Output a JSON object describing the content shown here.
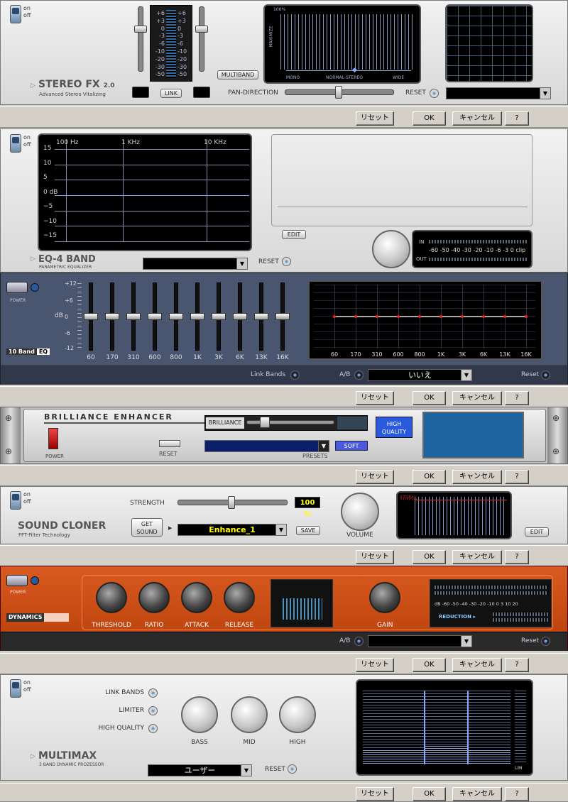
{
  "common": {
    "on": "on",
    "off": "off",
    "reset": "リセット",
    "ok": "OK",
    "cancel": "キャンセル",
    "help": "?"
  },
  "stereo": {
    "title": "STEREO FX",
    "version": "2.0",
    "subtitle": "Advanced Stereo Vitalizing",
    "scale": [
      "+6",
      "+3",
      "0",
      "-3",
      "-6",
      "-10",
      "-20",
      "-30",
      "-50"
    ],
    "link": "LINK",
    "multiband": "MULTIBAND",
    "pan": "PAN-DIRECTION",
    "reset": "RESET",
    "scr_top": "100%",
    "scr_max": "MAXIMIZE",
    "scr_mono": "MONO",
    "scr_norm": "NORMAL-STEREO",
    "scr_wide": "WIDE"
  },
  "eq4": {
    "title": "EQ-4 BAND",
    "subtitle": "PARAMETRIC EQUALIZER",
    "freq": [
      "100 Hz",
      "1 KHz",
      "10 KHz"
    ],
    "db": [
      "15",
      "10",
      "5",
      "0 dB",
      "−5",
      "−10",
      "−15"
    ],
    "edit": "EDIT",
    "reset": "RESET",
    "in": "IN",
    "out": "OUT",
    "meter": "-60 -50 -40 -30 -20 -10 -6  -3  0  clip"
  },
  "eq10": {
    "power": "POWER",
    "badge_a": "10 Band",
    "badge_b": "EQ",
    "db": [
      "+12",
      "+6",
      "dB",
      "0",
      "-6",
      "-12"
    ],
    "bands": [
      "60",
      "170",
      "310",
      "600",
      "800",
      "1K",
      "3K",
      "6K",
      "13K",
      "16K"
    ],
    "link_bands": "Link Bands",
    "ab": "A/B",
    "preset": "いいえ",
    "reset": "Reset"
  },
  "brill": {
    "title": "BRILLIANCE ENHANCER",
    "power": "POWER",
    "reset": "RESET",
    "brilliance": "BRILLIANCE",
    "presets": "PRESETS",
    "soft": "SOFT",
    "hq1": "HIGH",
    "hq2": "QUALITY"
  },
  "cloner": {
    "title": "SOUND CLONER",
    "subtitle": "FFT-Filter Technology",
    "strength": "STRENGTH",
    "pct": "100 %",
    "get1": "GET",
    "get2": "SOUND",
    "preset": "Enhance_1",
    "save": "SAVE",
    "volume": "VOLUME",
    "edit": "EDIT",
    "tag": "ﾘｱﾙﾀｲﾑ"
  },
  "dyn": {
    "power": "POWER",
    "badge": "DYNAMICS",
    "knobs": [
      "THRESHOLD",
      "RATIO",
      "ATTACK",
      "RELEASE"
    ],
    "gain": "GAIN",
    "meter": "dB  -60 -50 -40 -30 -20 -10  0  3  10  20",
    "reduction": "REDUCTION ▸",
    "ab": "A/B",
    "reset": "Reset"
  },
  "multimax": {
    "title": "MULTIMAX",
    "subtitle": "3 BAND DYNAMIC PROZESSOR",
    "opts": [
      "LINK BANDS",
      "LIMITER",
      "HIGH QUALITY"
    ],
    "knobs": [
      "BASS",
      "MID",
      "HIGH"
    ],
    "preset": "ユーザー",
    "reset": "RESET",
    "lim": "LIM"
  }
}
